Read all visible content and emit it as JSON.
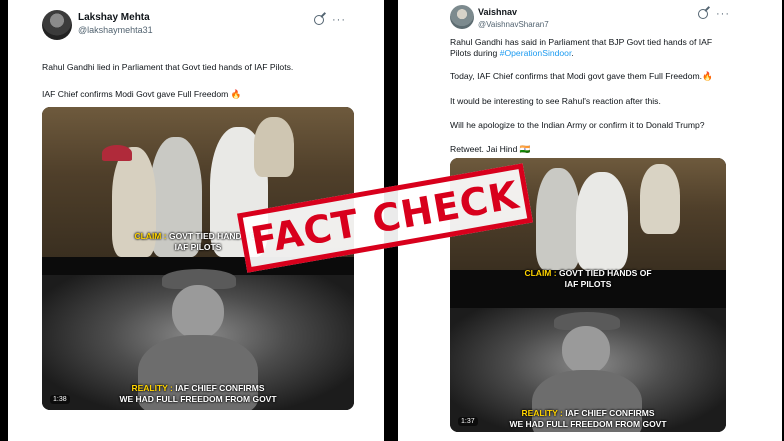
{
  "left_tweet": {
    "name": "Lakshay Mehta",
    "handle": "@lakshaymehta31",
    "line1": "Rahul Gandhi lied in Parliament that Govt tied hands of IAF Pilots.",
    "line2": "IAF Chief confirms Modi Govt gave Full Freedom 🔥",
    "video": {
      "claim_tag": "CLAIM :",
      "claim_text1": "GOVT TIED HANDS OF",
      "claim_text2": "IAF PILOTS",
      "reality_tag": "REALITY :",
      "reality_text1": "IAF CHIEF CONFIRMS",
      "reality_text2": "WE HAD FULL FREEDOM FROM GOVT",
      "duration": "1:38"
    }
  },
  "right_tweet": {
    "name": "Vaishnav",
    "handle": "@VaishnavSharan7",
    "line1": "Rahul Gandhi has said in Parliament that BJP Govt tied hands of IAF",
    "line2_pre": "Pilots during ",
    "line2_hashtag": "#OperationSindoor",
    "line2_post": ".",
    "line3": "Today, IAF Chief confirms that Modi govt gave them Full Freedom.🔥",
    "line4": "It would be interesting to see Rahul's reaction after this.",
    "line5": "Will he apologize to the Indian Army or confirm it to Donald Trump?",
    "line6": "Retweet. Jai Hind 🇮🇳",
    "video": {
      "claim_tag": "CLAIM :",
      "claim_text1": "GOVT TIED HANDS OF",
      "claim_text2": "IAF PILOTS",
      "reality_tag": "REALITY :",
      "reality_text1": "IAF CHIEF CONFIRMS",
      "reality_text2": "WE HAD FULL FREEDOM FROM GOVT",
      "duration": "1:37"
    }
  },
  "stamp": {
    "text": "FACT CHECK",
    "color": "#d8001c"
  },
  "icons": {
    "grok": "grok-icon",
    "more": "more-icon"
  },
  "colors": {
    "hashtag": "#1d9bf0",
    "caption_tag": "#ffd400"
  }
}
